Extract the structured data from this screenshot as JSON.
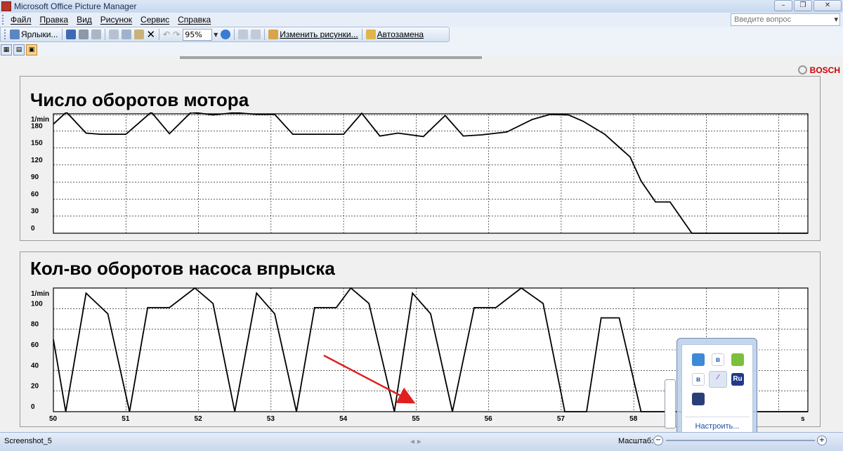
{
  "window": {
    "title": "Microsoft Office Picture Manager",
    "help_placeholder": "Введите вопрос"
  },
  "menu": [
    "Файл",
    "Правка",
    "Вид",
    "Рисунок",
    "Сервис",
    "Справка"
  ],
  "toolbar": {
    "shortcuts_label": "Ярлыки...",
    "zoom_value": "95%",
    "edit_label": "Изменить рисунки...",
    "autocorrect_label": "Автозамена"
  },
  "document": {
    "brand": "BOSCH"
  },
  "charts": [
    {
      "title": "Число оборотов мотора",
      "unit_label": "1/min",
      "y_ticks": [
        "180",
        "150",
        "120",
        "90",
        "60",
        "30",
        "0"
      ]
    },
    {
      "title": "Кол-во оборотов насоса впрыска",
      "unit_label": "1/min",
      "y_ticks": [
        "100",
        "80",
        "60",
        "40",
        "20",
        "0"
      ],
      "x_ticks": [
        "50",
        "51",
        "52",
        "53",
        "54",
        "55",
        "56",
        "57",
        "58"
      ],
      "x_unit": "s"
    }
  ],
  "chart_data": [
    {
      "type": "line",
      "title": "Число оборотов мотора",
      "ylabel": "1/min",
      "ylim": [
        0,
        210
      ],
      "x": [
        50.0,
        50.18,
        50.45,
        50.65,
        51.0,
        51.35,
        51.6,
        51.9,
        52.2,
        52.5,
        52.8,
        53.05,
        53.3,
        53.7,
        54.0,
        54.25,
        54.5,
        54.75,
        55.1,
        55.4,
        55.65,
        55.9,
        56.25,
        56.6,
        56.85,
        57.1,
        57.3,
        57.6,
        57.95,
        58.1,
        58.3,
        58.5,
        58.8,
        59.1,
        60.4
      ],
      "y": [
        192,
        213,
        176,
        174,
        174,
        213,
        175,
        213,
        208,
        212,
        209,
        209,
        174,
        174,
        174,
        211,
        171,
        176,
        170,
        207,
        171,
        173,
        178,
        200,
        209,
        208,
        197,
        174,
        134,
        92,
        55,
        55,
        0,
        0,
        0
      ],
      "grid": true
    },
    {
      "type": "line",
      "title": "Кол-во оборотов насоса впрыска",
      "ylabel": "1/min",
      "ylim": [
        0,
        120
      ],
      "xlim": [
        50,
        60.4
      ],
      "x": [
        50.0,
        50.17,
        50.45,
        50.75,
        51.05,
        51.3,
        51.6,
        51.95,
        52.2,
        52.5,
        52.8,
        53.05,
        53.35,
        53.6,
        53.9,
        54.1,
        54.35,
        54.7,
        54.95,
        55.2,
        55.5,
        55.8,
        56.1,
        56.45,
        56.75,
        57.05,
        57.35,
        57.55,
        57.8,
        58.1,
        58.35,
        60.4
      ],
      "y": [
        70,
        0,
        115,
        95,
        0,
        101,
        101,
        120,
        105,
        0,
        115,
        95,
        0,
        101,
        101,
        120,
        105,
        0,
        115,
        95,
        0,
        101,
        101,
        120,
        105,
        0,
        0,
        91,
        91,
        0,
        0,
        0
      ],
      "x_unit": "s",
      "grid": true
    }
  ],
  "status": {
    "text": "Screenshot_5",
    "scale_label": "Масштаб:"
  },
  "tray": {
    "customize_label": "Настроить...",
    "lang_label": "Ru"
  },
  "colors": {
    "accent": "#1b4fa0",
    "brand": "#cc0000",
    "annotation": "#e02020"
  }
}
